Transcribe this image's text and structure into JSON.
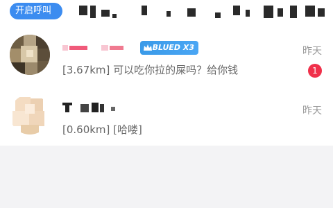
{
  "top_bar": {
    "pill_label": "开启呼叫"
  },
  "conversations": [
    {
      "badge": "BLUED X3",
      "time": "昨天",
      "message": "[3.67km] 可以吃你拉的屎吗？给你钱",
      "unread": "1"
    },
    {
      "time": "昨天",
      "message": "[0.60km] [哈喽]"
    }
  ],
  "colors": {
    "accent": "#3c8cf0",
    "badge_blue": "#3a9ae8",
    "unread_red": "#f0304a",
    "muted_text": "#9a9a9a"
  }
}
